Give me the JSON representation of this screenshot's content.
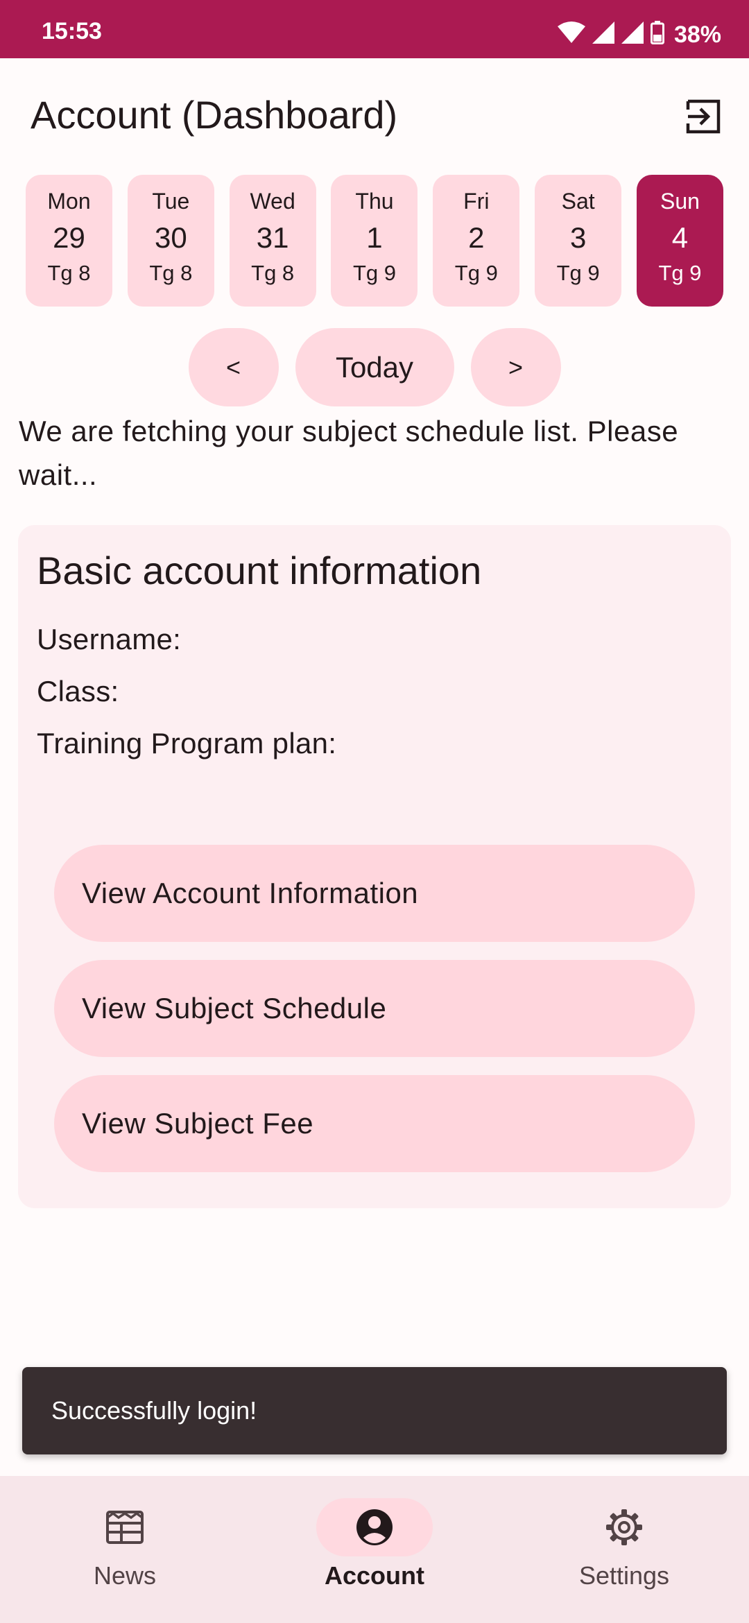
{
  "status_bar": {
    "time": "15:53",
    "battery": "38%",
    "icons": [
      "wifi-icon",
      "signal-icon",
      "signal-icon",
      "battery-icon"
    ]
  },
  "header": {
    "title": "Account (Dashboard)",
    "logout_icon": "logout-icon"
  },
  "week": [
    {
      "day": "Mon",
      "date": "29",
      "week": "Tg 8",
      "selected": false
    },
    {
      "day": "Tue",
      "date": "30",
      "week": "Tg 8",
      "selected": false
    },
    {
      "day": "Wed",
      "date": "31",
      "week": "Tg 8",
      "selected": false
    },
    {
      "day": "Thu",
      "date": "1",
      "week": "Tg 9",
      "selected": false
    },
    {
      "day": "Fri",
      "date": "2",
      "week": "Tg 9",
      "selected": false
    },
    {
      "day": "Sat",
      "date": "3",
      "week": "Tg 9",
      "selected": false
    },
    {
      "day": "Sun",
      "date": "4",
      "week": "Tg 9",
      "selected": true
    }
  ],
  "week_nav": {
    "prev_label": "<",
    "today_label": "Today",
    "next_label": ">"
  },
  "schedule": {
    "status_message": "We are fetching your subject schedule list. Please wait..."
  },
  "account_card": {
    "title": "Basic account information",
    "username_label": "Username:",
    "class_label": "Class:",
    "program_label": "Training Program plan:",
    "buttons": [
      {
        "label": "View Account Information"
      },
      {
        "label": "View Subject Schedule"
      },
      {
        "label": "View Subject Fee"
      }
    ]
  },
  "snackbar": {
    "message": "Successfully login!"
  },
  "bottom_nav": {
    "items": [
      {
        "label": "News",
        "icon": "news-icon",
        "active": false
      },
      {
        "label": "Account",
        "icon": "account-icon",
        "active": true
      },
      {
        "label": "Settings",
        "icon": "settings-icon",
        "active": false
      }
    ]
  },
  "colors": {
    "primary": "#ab1a52",
    "day_card": "#ffd9e0",
    "card_bg": "#fdeff2",
    "snackbar_bg": "#382e30",
    "bottom_nav_bg": "#f7e6ea"
  }
}
